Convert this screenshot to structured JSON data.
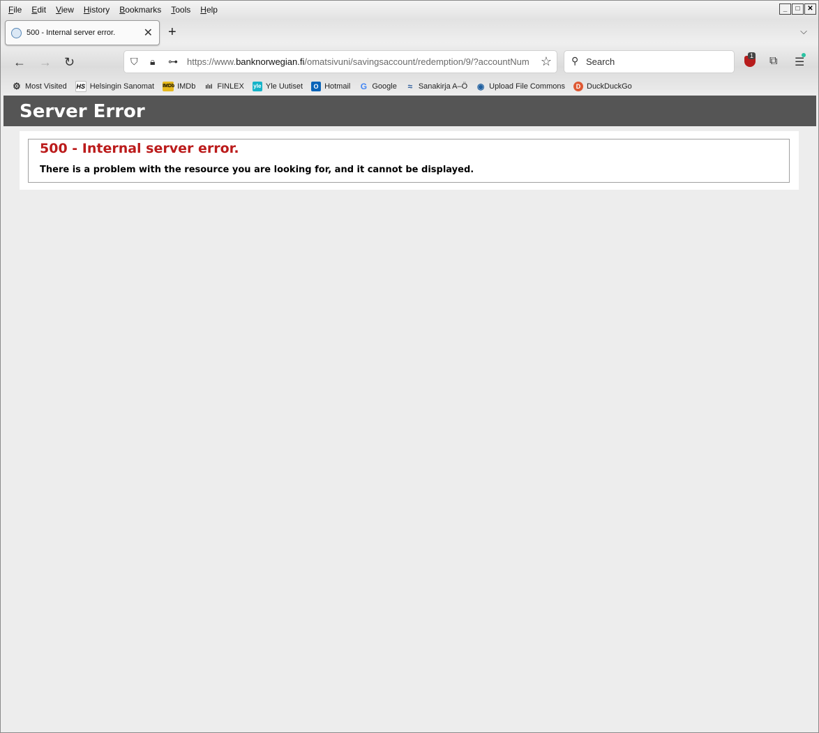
{
  "menubar": {
    "items": [
      "File",
      "Edit",
      "View",
      "History",
      "Bookmarks",
      "Tools",
      "Help"
    ]
  },
  "tab": {
    "title": "500 - Internal server error."
  },
  "urlbar": {
    "url_prefix": "https://www.",
    "url_domain": "banknorwegian.fi",
    "url_path": "/omatsivuni/savingsaccount/redemption/9/?accountNum"
  },
  "search": {
    "placeholder": "Search"
  },
  "extension": {
    "badge": "1"
  },
  "bookmarks": [
    {
      "label": "Most Visited",
      "icon": "gear-icon"
    },
    {
      "label": "Helsingin Sanomat",
      "icon": "hs-icon",
      "icon_text": "HS"
    },
    {
      "label": "IMDb",
      "icon": "imdb-icon",
      "icon_text": "IMDb"
    },
    {
      "label": "FINLEX",
      "icon": "finlex-icon",
      "icon_text": "ılıl"
    },
    {
      "label": "Yle Uutiset",
      "icon": "yle-icon",
      "icon_text": "yle"
    },
    {
      "label": "Hotmail",
      "icon": "outlook-icon",
      "icon_text": "O"
    },
    {
      "label": "Google",
      "icon": "google-icon",
      "icon_text": "G"
    },
    {
      "label": "Sanakirja A–Ö",
      "icon": "sanakirja-icon",
      "icon_text": "≈"
    },
    {
      "label": "Upload File Commons",
      "icon": "commons-icon",
      "icon_text": "◉"
    },
    {
      "label": "DuckDuckGo",
      "icon": "duckduckgo-icon",
      "icon_text": "D"
    }
  ],
  "page": {
    "header": "Server Error",
    "error_title": "500 - Internal server error.",
    "error_message": "There is a problem with the resource you are looking for, and it cannot be displayed."
  },
  "colors": {
    "header_bg": "#555555",
    "error_red": "#bb1b1b"
  }
}
